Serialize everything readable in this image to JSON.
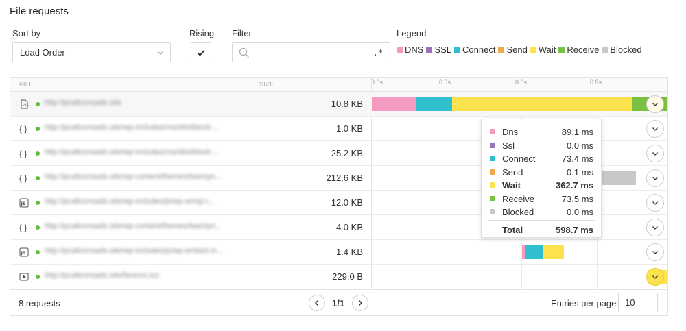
{
  "title": "File requests",
  "controls": {
    "sort_label": "Sort by",
    "sort_value": "Load Order",
    "rising_label": "Rising",
    "filter_label": "Filter",
    "filter_placeholder": "",
    "filter_regex": ".*",
    "legend_label": "Legend"
  },
  "legend": [
    {
      "name": "DNS",
      "color": "#f39bc1"
    },
    {
      "name": "SSL",
      "color": "#9b72b7"
    },
    {
      "name": "Connect",
      "color": "#2fbfcd"
    },
    {
      "name": "Send",
      "color": "#f0a84b"
    },
    {
      "name": "Wait",
      "color": "#fce24f"
    },
    {
      "name": "Receive",
      "color": "#7ac143"
    },
    {
      "name": "Blocked",
      "color": "#c8c8c8"
    }
  ],
  "table": {
    "col_file": "FILE",
    "col_size": "SIZE",
    "ticks": [
      "0.0s",
      "0.3s",
      "0.6s",
      "0.9s"
    ],
    "rows": [
      {
        "icon": "html-file-icon",
        "url": "http://pcaltconsads.site",
        "size": "10.8 KB"
      },
      {
        "icon": "json-file-icon",
        "url": "http://pcaltconsads.site/wp-includes/css/dist/block-...",
        "size": "1.0 KB"
      },
      {
        "icon": "json-file-icon",
        "url": "http://pcaltconsads.site/wp-includes/css/dist/block-...",
        "size": "25.2 KB"
      },
      {
        "icon": "json-file-icon",
        "url": "http://pcaltconsads.site/wp-content/themes/twentyn...",
        "size": "212.6 KB"
      },
      {
        "icon": "js-file-icon",
        "url": "http://pcaltconsads.site/wp-includes/js/wp-emoji-r...",
        "size": "12.0 KB"
      },
      {
        "icon": "json-file-icon",
        "url": "http://pcaltconsads.site/wp-content/themes/twentyn...",
        "size": "4.0 KB"
      },
      {
        "icon": "js-file-icon",
        "url": "http://pcaltconsads.site/wp-includes/js/wp-embed.m...",
        "size": "1.4 KB"
      },
      {
        "icon": "video-file-icon",
        "url": "http://pcaltconsads.site/favicon.ico",
        "size": "229.0 B"
      }
    ]
  },
  "footer": {
    "requests": "8 requests",
    "page": "1/1",
    "entries_label": "Entries per page:",
    "entries_value": "10"
  },
  "tooltip": {
    "rows": [
      {
        "name": "Dns",
        "value": "89.1 ms",
        "color": "#f39bc1"
      },
      {
        "name": "Ssl",
        "value": "0.0 ms",
        "color": "#9b72b7"
      },
      {
        "name": "Connect",
        "value": "73.4 ms",
        "color": "#2fbfcd"
      },
      {
        "name": "Send",
        "value": "0.1 ms",
        "color": "#f0a84b"
      },
      {
        "name": "Wait",
        "value": "362.7 ms",
        "color": "#fce24f"
      },
      {
        "name": "Receive",
        "value": "73.5 ms",
        "color": "#7ac143"
      },
      {
        "name": "Blocked",
        "value": "0.0 ms",
        "color": "#c8c8c8"
      }
    ],
    "total_label": "Total",
    "total_value": "598.7 ms"
  }
}
